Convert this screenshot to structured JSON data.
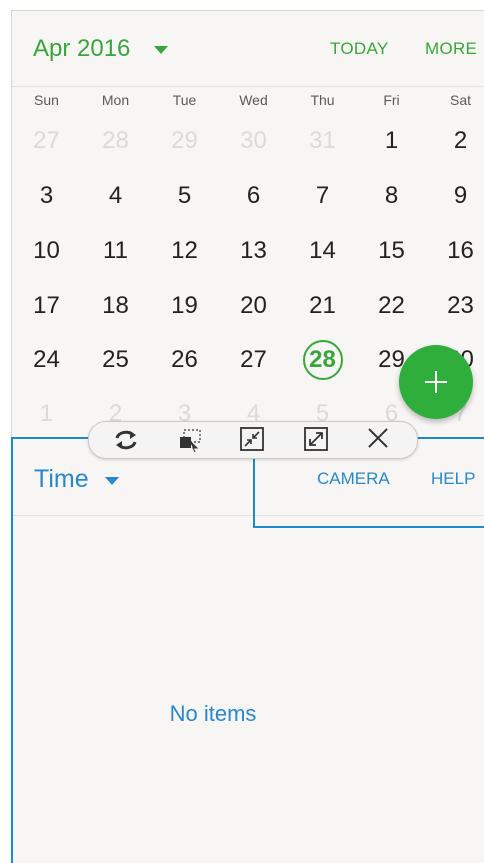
{
  "calendar": {
    "month_title": "Apr 2016",
    "today_label": "TODAY",
    "more_label": "MORE",
    "weekdays": [
      "Sun",
      "Mon",
      "Tue",
      "Wed",
      "Thu",
      "Fri",
      "Sat"
    ],
    "weeks": [
      [
        "27",
        "28",
        "29",
        "30",
        "31",
        "1",
        "2"
      ],
      [
        "3",
        "4",
        "5",
        "6",
        "7",
        "8",
        "9"
      ],
      [
        "10",
        "11",
        "12",
        "13",
        "14",
        "15",
        "16"
      ],
      [
        "17",
        "18",
        "19",
        "20",
        "21",
        "22",
        "23"
      ],
      [
        "24",
        "25",
        "26",
        "27",
        "28",
        "29",
        "30"
      ],
      [
        "1",
        "2",
        "3",
        "4",
        "5",
        "6",
        "7"
      ]
    ],
    "selected_day": "28",
    "accent_color": "#3aa53a"
  },
  "toolbar": {
    "icons": [
      "switch-windows-icon",
      "drag-content-icon",
      "minimize-icon",
      "maximize-icon",
      "close-icon"
    ]
  },
  "bottom": {
    "title": "Time",
    "camera_label": "CAMERA",
    "help_label": "HELP",
    "empty_text": "No items",
    "accent_color": "#2a87c8"
  }
}
